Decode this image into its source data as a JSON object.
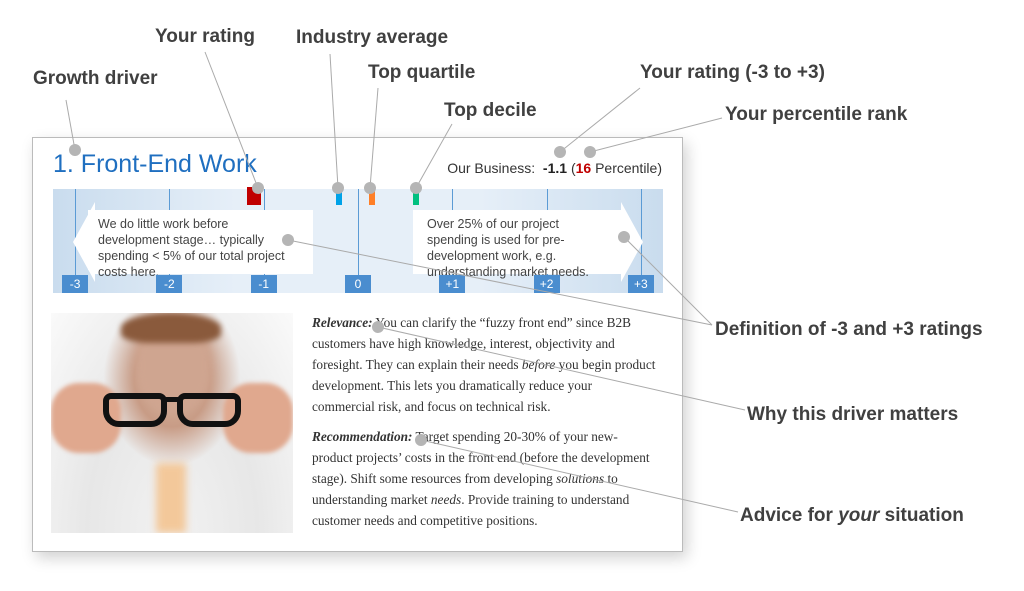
{
  "card": {
    "title": "1. Front-End Work",
    "our_business_label": "Our Business:",
    "rating": "-1.1",
    "percentile_open": "(",
    "percentile": "16",
    "percentile_label": "Percentile)",
    "scale": {
      "ticks": [
        "-3",
        "-2",
        "-1",
        "0",
        "+1",
        "+2",
        "+3"
      ],
      "your_rating": -1.1,
      "industry_average": -0.2,
      "top_quartile": 0.15,
      "top_decile": 0.62,
      "left_definition": "We do little work before development stage… typically spending < 5% of our total project costs here.",
      "right_definition": "Over 25% of our project spending is used for pre-development work, e.g. understanding market needs.",
      "colors": {
        "your_rating": "#c00000",
        "industry_average": "#00a2e8",
        "top_quartile": "#ff7f27",
        "top_decile": "#00c080"
      }
    },
    "relevance": {
      "label": "Relevance:",
      "t1": " You can clarify the “fuzzy front end” since B2B customers have high knowledge, interest, objectivity and foresight. They can explain their needs ",
      "em": "before",
      "t2": " you begin product development. This lets you dramatically reduce your commercial risk, and focus on technical risk."
    },
    "recommendation": {
      "label": "Recommendation:",
      "t1": " Target spending 20-30% of your new-product projects’ costs in the front end (before the development stage). Shift some resources from developing ",
      "em1": "solutions",
      "t2": " to understanding market ",
      "em2": "needs",
      "t3": ". Provide training to understand customer needs and competitive positions."
    }
  },
  "annotations": {
    "growth_driver": "Growth driver",
    "your_rating": "Your rating",
    "industry_average": "Industry average",
    "top_quartile": "Top quartile",
    "top_decile": "Top decile",
    "rating_range": "Your rating (-3 to +3)",
    "percentile_rank": "Your percentile rank",
    "definition": "Definition of -3 and +3 ratings",
    "why": "Why this driver matters",
    "advice_pre": "Advice for ",
    "advice_em": "your",
    "advice_post": " situation"
  }
}
